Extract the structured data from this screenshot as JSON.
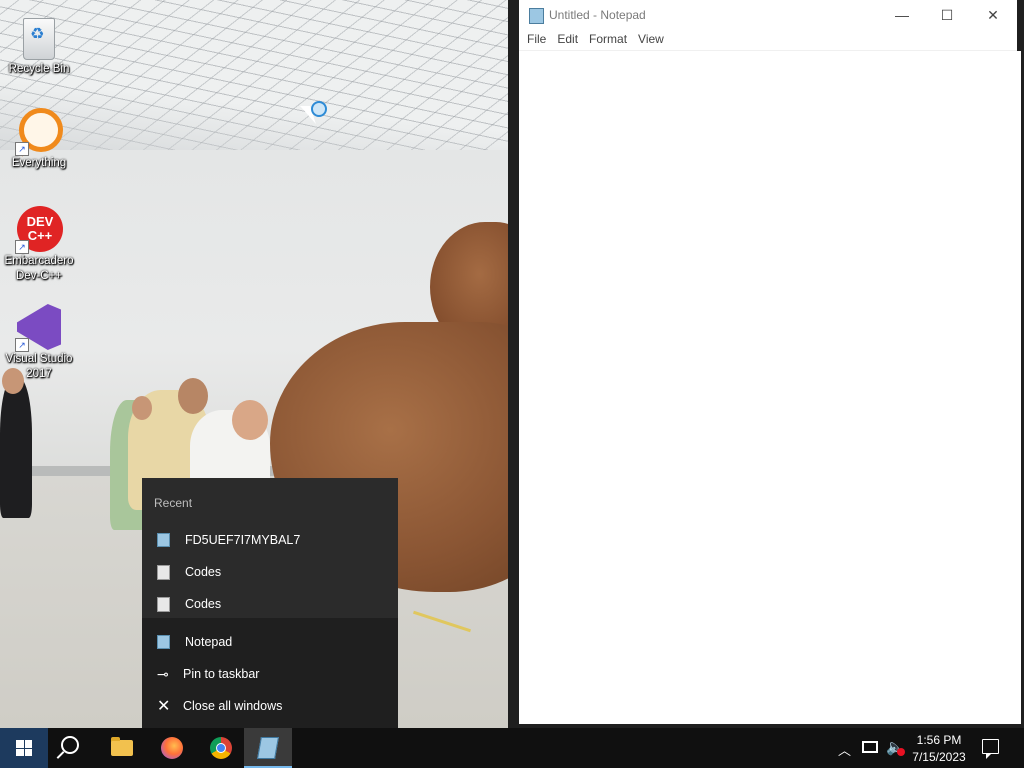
{
  "desktop": {
    "icons": [
      {
        "label": "Recycle Bin",
        "icon": "recycle-bin-icon"
      },
      {
        "label": "Everything",
        "icon": "everything-search-icon"
      },
      {
        "label": "Embarcadero Dev-C++",
        "icon": "dev-cpp-icon",
        "glyph_text": "DEV C++"
      },
      {
        "label": "Visual Studio 2017",
        "icon": "visual-studio-icon"
      }
    ]
  },
  "notepad": {
    "title": "Untitled - Notepad",
    "menu": [
      "File",
      "Edit",
      "Format",
      "View"
    ],
    "content": "",
    "controls": {
      "minimize": "—",
      "maximize": "☐",
      "close": "✕"
    }
  },
  "jump_list": {
    "header": "Recent",
    "recent": [
      {
        "label": "FD5UEF7I7MYBAL7",
        "icon": "notepad-file-icon"
      },
      {
        "label": "Codes",
        "icon": "document-icon"
      },
      {
        "label": "Codes",
        "icon": "document-icon"
      }
    ],
    "tasks": [
      {
        "label": "Notepad",
        "icon": "notepad-icon"
      },
      {
        "label": "Pin to taskbar",
        "icon": "pin-icon"
      },
      {
        "label": "Close all windows",
        "icon": "close-icon"
      }
    ]
  },
  "taskbar": {
    "apps": [
      "start",
      "search",
      "file-explorer",
      "firefox",
      "chrome",
      "notepad"
    ],
    "active_app": "notepad",
    "tray": {
      "time": "1:56 PM",
      "date": "7/15/2023",
      "volume_muted": true
    }
  },
  "colors": {
    "taskbar": "#101010",
    "jumplist": "#2b2b2b",
    "accent": "#76b9ed"
  }
}
